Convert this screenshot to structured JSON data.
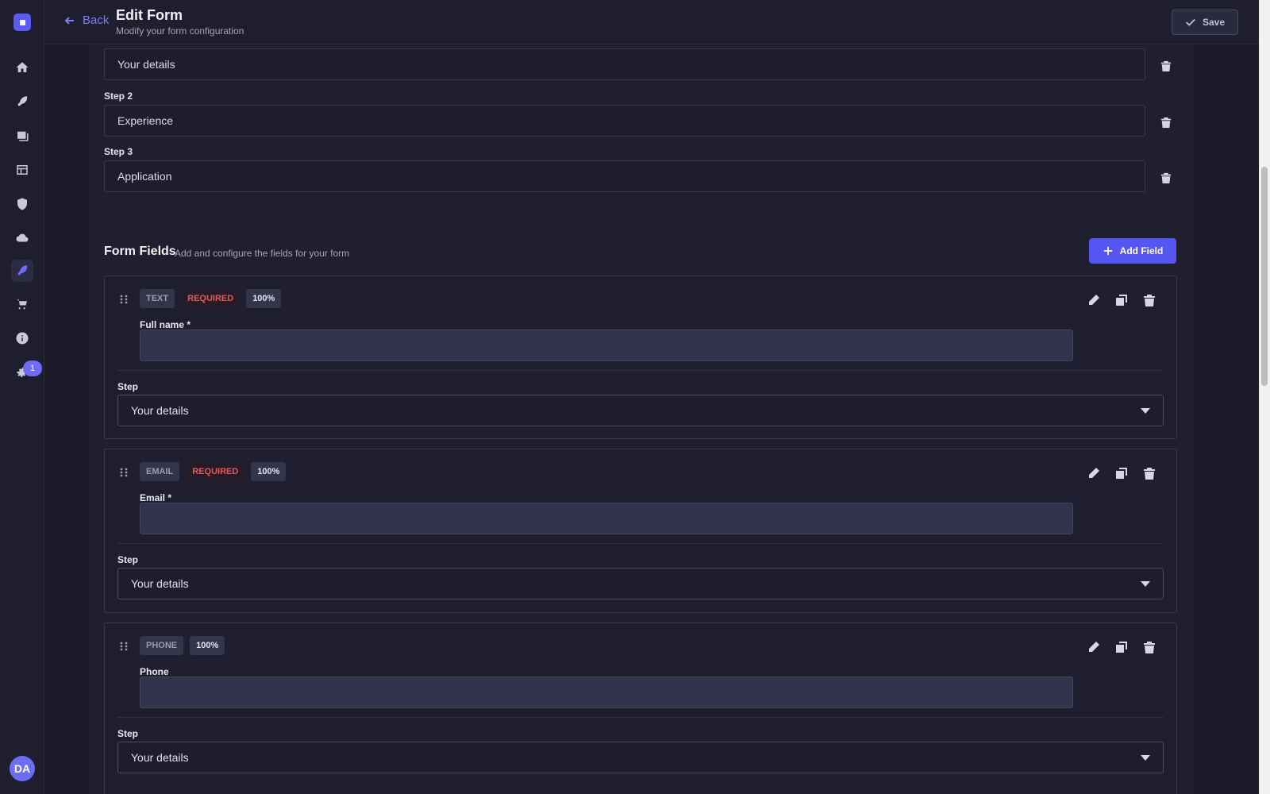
{
  "header": {
    "back_label": "Back",
    "title": "Edit Form",
    "subtitle": "Modify your form configuration",
    "save_label": "Save"
  },
  "sidebar": {
    "items": [
      {
        "icon": "home-icon"
      },
      {
        "icon": "feather-icon"
      },
      {
        "icon": "images-icon"
      },
      {
        "icon": "layout-icon"
      },
      {
        "icon": "shield-icon"
      },
      {
        "icon": "cloud-icon"
      },
      {
        "icon": "feather-icon",
        "active": true
      },
      {
        "icon": "cart-icon"
      },
      {
        "icon": "info-icon"
      },
      {
        "icon": "gear-icon"
      }
    ],
    "settings_badge": "1",
    "avatar_initials": "DA"
  },
  "steps": [
    {
      "label": "",
      "value": "Your details"
    },
    {
      "label": "Step 2",
      "value": "Experience"
    },
    {
      "label": "Step 3",
      "value": "Application"
    }
  ],
  "form_fields": {
    "title": "Form Fields",
    "subtitle": "Add and configure the fields for your form",
    "add_label": "Add Field",
    "step_label": "Step",
    "items": [
      {
        "type": "TEXT",
        "required": "REQUIRED",
        "width": "100%",
        "label": "Full name *",
        "step": "Your details"
      },
      {
        "type": "EMAIL",
        "required": "REQUIRED",
        "width": "100%",
        "label": "Email *",
        "step": "Your details"
      },
      {
        "type": "PHONE",
        "required": "",
        "width": "100%",
        "label": "Phone",
        "step": "Your details"
      }
    ]
  },
  "colors": {
    "accent": "#5555f2",
    "required": "#e35a5a",
    "background": "#1b1b2a"
  }
}
